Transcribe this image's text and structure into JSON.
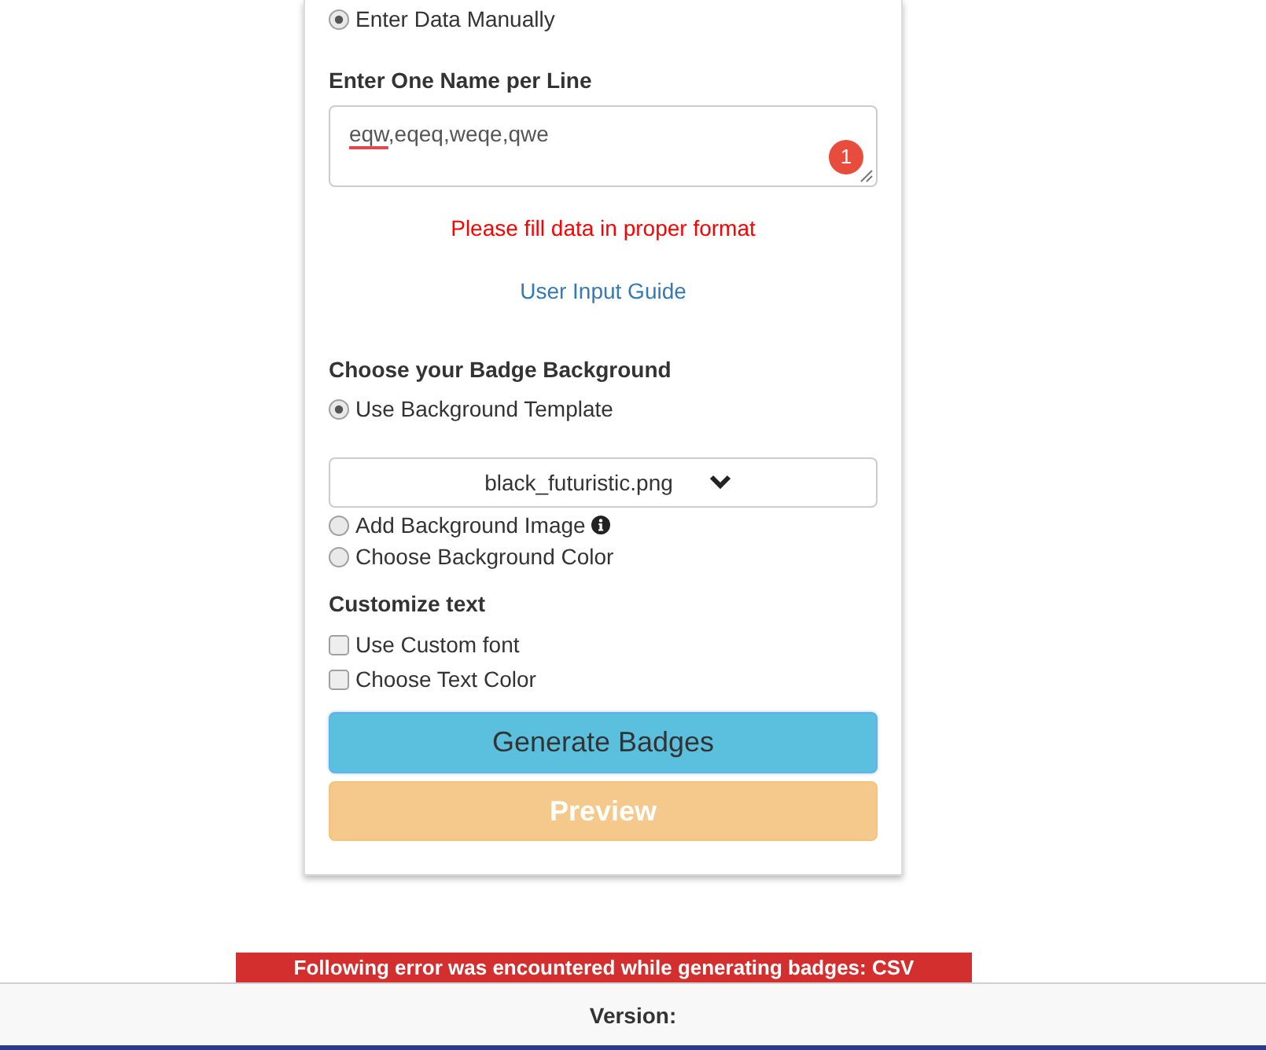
{
  "data_source": {
    "options": [
      {
        "label": "Enter Data Manually",
        "selected": true
      }
    ]
  },
  "names_field": {
    "label": "Enter One Name per Line",
    "value_parts": [
      {
        "text": "eqw",
        "misspelled": true
      },
      {
        "text": ",eqeq,weqe,qwe",
        "misspelled": false
      }
    ],
    "error_count": "1"
  },
  "validation_message": "Please fill data in proper format",
  "guide_link": "User Input Guide",
  "background": {
    "heading": "Choose your Badge Background",
    "options": [
      {
        "label": "Use Background Template",
        "selected": true,
        "info": false,
        "select_value": "black_futuristic.png"
      },
      {
        "label": "Add Background Image",
        "selected": false,
        "info": true
      },
      {
        "label": "Choose Background Color",
        "selected": false,
        "info": false
      }
    ]
  },
  "customize_text": {
    "heading": "Customize text",
    "options": [
      {
        "label": "Use Custom font",
        "checked": false
      },
      {
        "label": "Choose Text Color",
        "checked": false
      }
    ]
  },
  "buttons": [
    {
      "label": "Generate Badges",
      "kind": "info",
      "focused": true,
      "disabled": false
    },
    {
      "label": "Preview",
      "kind": "warning",
      "focused": false,
      "disabled": true
    }
  ],
  "error_banner": {
    "text": "Following error was encountered while generating badges: CSV"
  },
  "footer": {
    "text": "Version:"
  }
}
